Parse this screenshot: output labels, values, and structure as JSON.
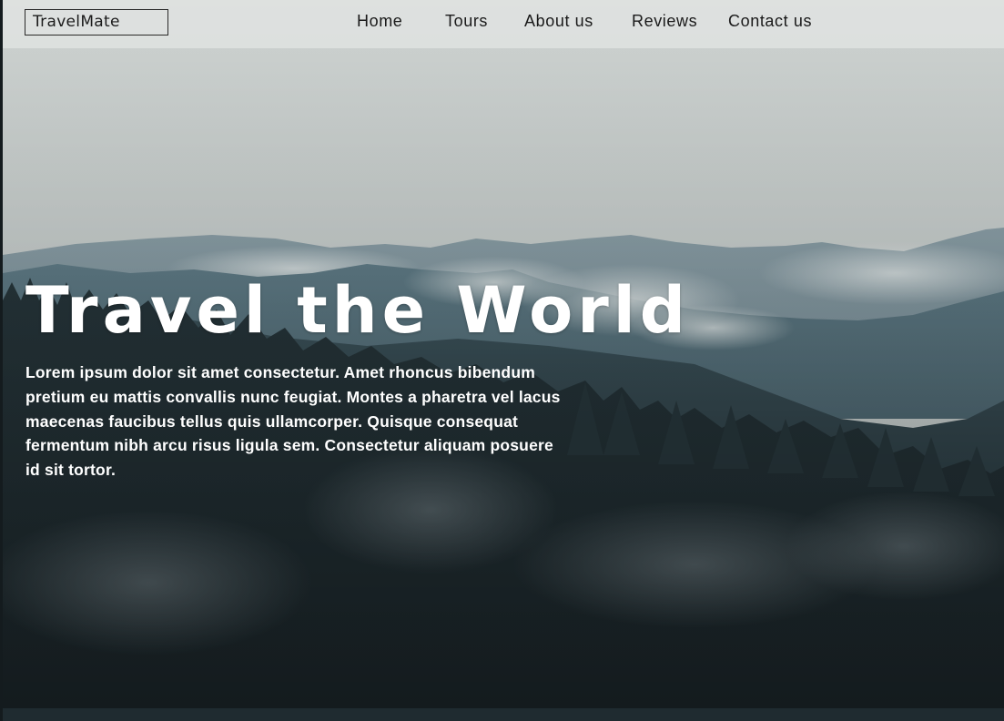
{
  "header": {
    "logo_text": "TravelMate",
    "nav": [
      {
        "label": "Home"
      },
      {
        "label": "Tours"
      },
      {
        "label": "About us"
      },
      {
        "label": "Reviews"
      },
      {
        "label": "Contact us"
      }
    ]
  },
  "hero": {
    "title": "Travel the World",
    "description": "Lorem ipsum dolor sit amet consectetur. Amet rhoncus bibendum pretium eu mattis convallis nunc feugiat. Montes a pharetra vel lacus maecenas faucibus tellus quis ullamcorper. Quisque consequat fermentum nibh arcu risus ligula sem. Consectetur aliquam posuere id sit tortor.",
    "background_image": "misty-mountain-forest"
  },
  "colors": {
    "nav_background": "#e1e4e3",
    "text_light": "#ffffff",
    "text_dark": "#1a1a1a",
    "footer_strip": "#1f2b30"
  }
}
